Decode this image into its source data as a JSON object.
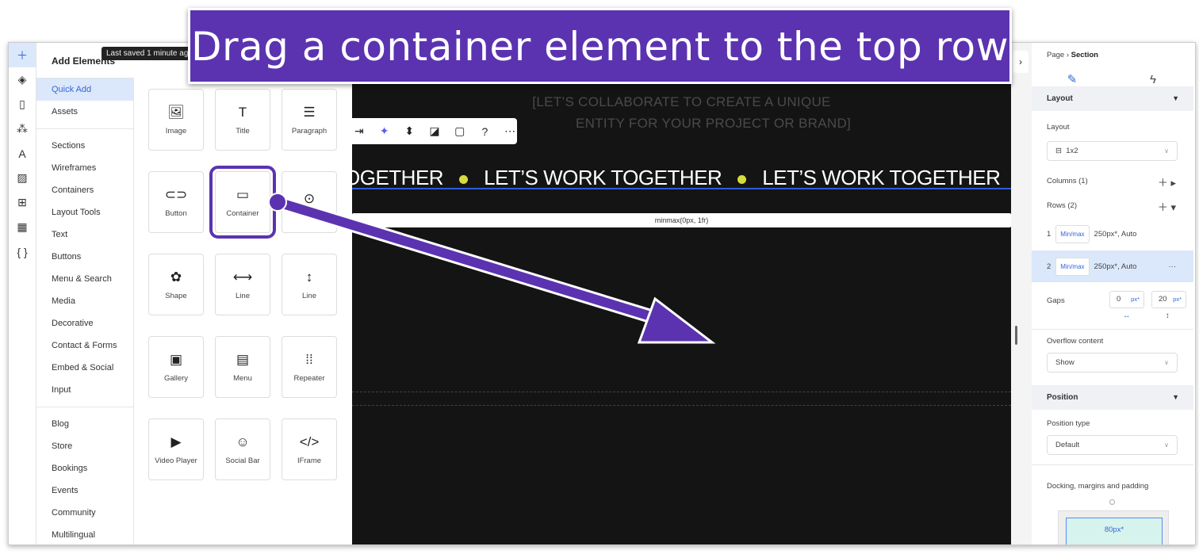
{
  "banner": {
    "text": "Drag a container element to the top row"
  },
  "sidebar": {
    "icons": [
      "plus-icon",
      "layers-icon",
      "page-icon",
      "apps-icon",
      "text-theme-icon",
      "media-icon",
      "grid-apps-icon",
      "table-icon",
      "code-icon"
    ]
  },
  "panel": {
    "title": "Add Elements",
    "tooltip": "Last saved 1 minute ago",
    "categories_top": [
      "Quick Add",
      "Assets"
    ],
    "categories": [
      "Sections",
      "Wireframes",
      "Containers",
      "Layout Tools",
      "Text",
      "Buttons",
      "Menu & Search",
      "Media",
      "Decorative",
      "Contact & Forms",
      "Embed & Social",
      "Input"
    ],
    "categories_apps": [
      "Blog",
      "Store",
      "Bookings",
      "Events",
      "Community",
      "Multilingual"
    ],
    "tiles": [
      {
        "label": "Image",
        "icon": "🖼"
      },
      {
        "label": "Title",
        "icon": "T"
      },
      {
        "label": "Paragraph",
        "icon": "☰"
      },
      {
        "label": "Button",
        "icon": "⊂⊃"
      },
      {
        "label": "Container",
        "icon": "▭"
      },
      {
        "label": "",
        "icon": "⊙"
      },
      {
        "label": "Shape",
        "icon": "✿"
      },
      {
        "label": "Line",
        "icon": "⟷"
      },
      {
        "label": "Line",
        "icon": "↕"
      },
      {
        "label": "Gallery",
        "icon": "▣"
      },
      {
        "label": "Menu",
        "icon": "▤"
      },
      {
        "label": "Repeater",
        "icon": "⁞⁞"
      },
      {
        "label": "Video Player",
        "icon": "▶"
      },
      {
        "label": "Social Bar",
        "icon": "☺"
      },
      {
        "label": "IFrame",
        "icon": "</>"
      }
    ]
  },
  "canvas": {
    "subtitle_1": "[LET’S COLLABORATE TO CREATE A UNIQUE",
    "subtitle_2": "ENTITY FOR YOUR PROJECT OR BRAND]",
    "marquee": [
      "OGETHER",
      "LET’S WORK TOGETHER",
      "LET’S WORK TOGETHER",
      "LET’S"
    ],
    "row_label": "minmax(0px, 1fr)",
    "toolbar": [
      "⇥",
      "✦",
      "⬍",
      "◪",
      "▢",
      "?",
      "⋯"
    ]
  },
  "inspector": {
    "breadcrumb_page": "Page",
    "breadcrumb_sep": "›",
    "breadcrumb_current": "Section",
    "tab_design": "✎",
    "tab_interactions": "ϟ",
    "layout_section": "Layout",
    "layout_label": "Layout",
    "layout_value": "1x2",
    "columns": "Columns (1)",
    "rows": "Rows (2)",
    "row1_num": "1",
    "row1_mode": "Min/max",
    "row1_value": "250px*, Auto",
    "row2_num": "2",
    "row2_mode": "Min/max",
    "row2_value": "250px*, Auto",
    "row2_more": "···",
    "gaps_label": "Gaps",
    "gap_h": "0",
    "gap_v": "20",
    "gap_unit": "px*",
    "overflow_label": "Overflow content",
    "overflow_value": "Show",
    "position_section": "Position",
    "position_type_label": "Position type",
    "position_type_value": "Default",
    "docking_label": "Docking, margins and padding",
    "margin_top": "80px*"
  },
  "colors": {
    "accent": "#5b33b0",
    "selection": "#3566d6",
    "marquee_dot": "#d6dc3a"
  }
}
